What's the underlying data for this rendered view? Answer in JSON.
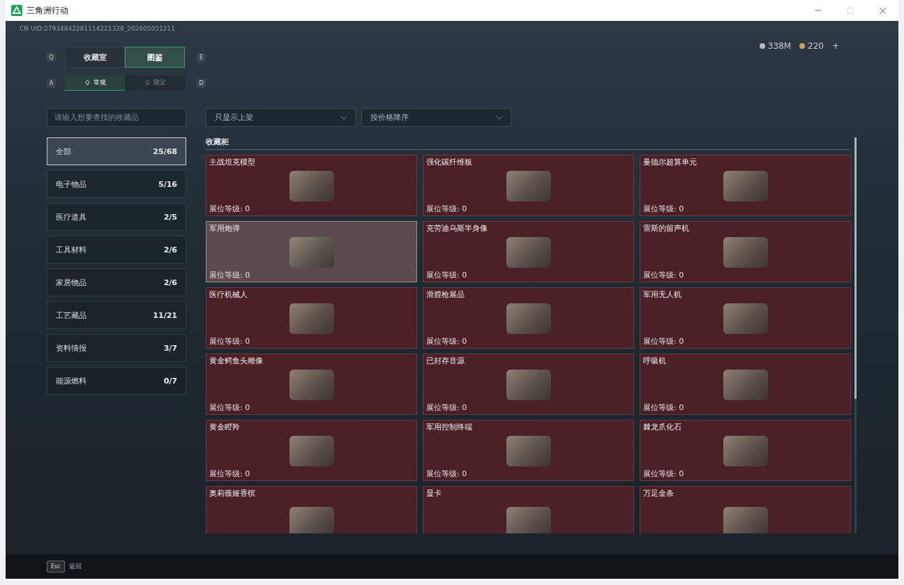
{
  "window": {
    "title": "三角洲行动"
  },
  "uid": "CN UID:27934842281114221328_202605051211",
  "currency": [
    {
      "amount": "338M",
      "color": "#b8bcc0"
    },
    {
      "amount": "220",
      "color": "#c9a25a"
    }
  ],
  "currency_add": "+",
  "tabs": {
    "prev_key": "Q",
    "next_key": "E",
    "items": [
      {
        "label": "收藏室",
        "selected": false
      },
      {
        "label": "图鉴",
        "selected": true
      }
    ]
  },
  "subtabs": {
    "prev_key": "A",
    "next_key": "D",
    "items": [
      {
        "label": "常规",
        "selected": true
      },
      {
        "label": "限定",
        "selected": false
      }
    ]
  },
  "search": {
    "placeholder": "请输入想要查找的收藏品"
  },
  "filters": [
    {
      "value": "只显示上架"
    },
    {
      "value": "按价格降序"
    }
  ],
  "sidebar": {
    "items": [
      {
        "label": "全部",
        "count": "25/68",
        "selected": true
      },
      {
        "label": "电子物品",
        "count": "5/16",
        "selected": false
      },
      {
        "label": "医疗道具",
        "count": "2/5",
        "selected": false
      },
      {
        "label": "工具材料",
        "count": "2/6",
        "selected": false
      },
      {
        "label": "家居物品",
        "count": "2/6",
        "selected": false
      },
      {
        "label": "工艺藏品",
        "count": "11/21",
        "selected": false
      },
      {
        "label": "资料情报",
        "count": "3/7",
        "selected": false
      },
      {
        "label": "能源燃料",
        "count": "0/7",
        "selected": false
      }
    ]
  },
  "section_title": "收藏柜",
  "level_label": "展位等级:",
  "cards": [
    {
      "name": "主战坦克模型",
      "level": "0",
      "highlighted": false
    },
    {
      "name": "强化碳纤维板",
      "level": "0",
      "highlighted": false
    },
    {
      "name": "曼德尔超算单元",
      "level": "0",
      "highlighted": false
    },
    {
      "name": "军用炮弹",
      "level": "0",
      "highlighted": true
    },
    {
      "name": "克劳迪乌斯半身像",
      "level": "0",
      "highlighted": false
    },
    {
      "name": "雷斯的留声机",
      "level": "0",
      "highlighted": false
    },
    {
      "name": "医疗机械人",
      "level": "0",
      "highlighted": false
    },
    {
      "name": "滑膛枪展品",
      "level": "0",
      "highlighted": false
    },
    {
      "name": "军用无人机",
      "level": "0",
      "highlighted": false
    },
    {
      "name": "黄金鳄鱼头雕像",
      "level": "0",
      "highlighted": false
    },
    {
      "name": "已封存音源",
      "level": "0",
      "highlighted": false
    },
    {
      "name": "呼吸机",
      "level": "0",
      "highlighted": false
    },
    {
      "name": "黄金瞪羚",
      "level": "0",
      "highlighted": false
    },
    {
      "name": "军用控制终端",
      "level": "0",
      "highlighted": false
    },
    {
      "name": "棘龙爪化石",
      "level": "0",
      "highlighted": false
    },
    {
      "name": "奥莉薇娅香槟",
      "highlighted": false
    },
    {
      "name": "显卡",
      "highlighted": false
    },
    {
      "name": "万足金条",
      "highlighted": false
    }
  ],
  "scrollbar": {
    "level": 0.66
  },
  "footer": {
    "key": "Esc",
    "label": "返回"
  }
}
